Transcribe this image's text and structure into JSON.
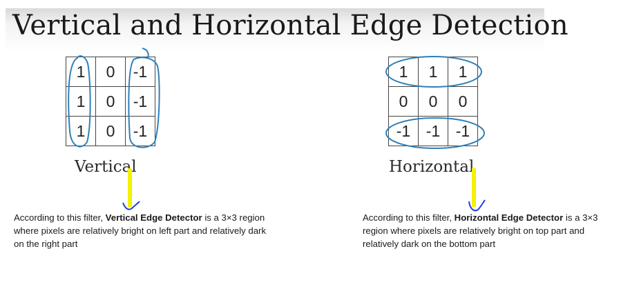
{
  "title": "Vertical and Horizontal Edge Detection",
  "vertical": {
    "caption": "Vertical",
    "matrix": [
      [
        "1",
        "0",
        "-1"
      ],
      [
        "1",
        "0",
        "-1"
      ],
      [
        "1",
        "0",
        "-1"
      ]
    ],
    "note": {
      "prefix": "According to this filter, ",
      "bold": "Vertical Edge Detector",
      "suffix": " is a 3×3 region where pixels are relatively bright on left part and relatively dark on the right part"
    }
  },
  "horizontal": {
    "caption": "Horizontal",
    "matrix": [
      [
        "1",
        "1",
        "1"
      ],
      [
        "0",
        "0",
        "0"
      ],
      [
        "-1",
        "-1",
        "-1"
      ]
    ],
    "note": {
      "prefix": "According to this filter, ",
      "bold": "Horizontal Edge Detector",
      "suffix": " is a 3×3 region where pixels are relatively bright on top part and relatively dark on the bottom part"
    }
  },
  "annotation_colors": {
    "pen_blue": "#2e7fb8",
    "highlighter_yellow": "#f4f200",
    "check_blue": "#1f3fe0"
  }
}
